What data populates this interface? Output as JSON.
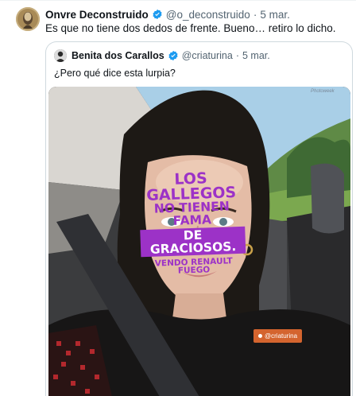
{
  "tweet": {
    "author_name": "Onvre Deconstruido",
    "handle": "@o_deconstruido",
    "separator": "·",
    "date": "5 mar.",
    "text": "Es que no tiene dos dedos de frente. Bueno… retiro lo dicho.",
    "verified_color": "#1d9bf0"
  },
  "quote": {
    "author_name": "Benita dos Carallos",
    "handle": "@criaturina",
    "separator": "·",
    "date": "5 mar.",
    "text": "¿Pero qué dice esta lurpia?",
    "image": {
      "sticker_line1": "LOS GALLEGOS",
      "sticker_line2": "NO TIENEN FAMA",
      "sticker_line3": "DE GRACIOSOS.",
      "sticker_line4": "VENDO RENAULT FUEGO",
      "tag_text": "@criaturina",
      "watermark": "Photoweek",
      "sticker_color": "#9c32c7",
      "tag_color": "#d4642e"
    }
  }
}
